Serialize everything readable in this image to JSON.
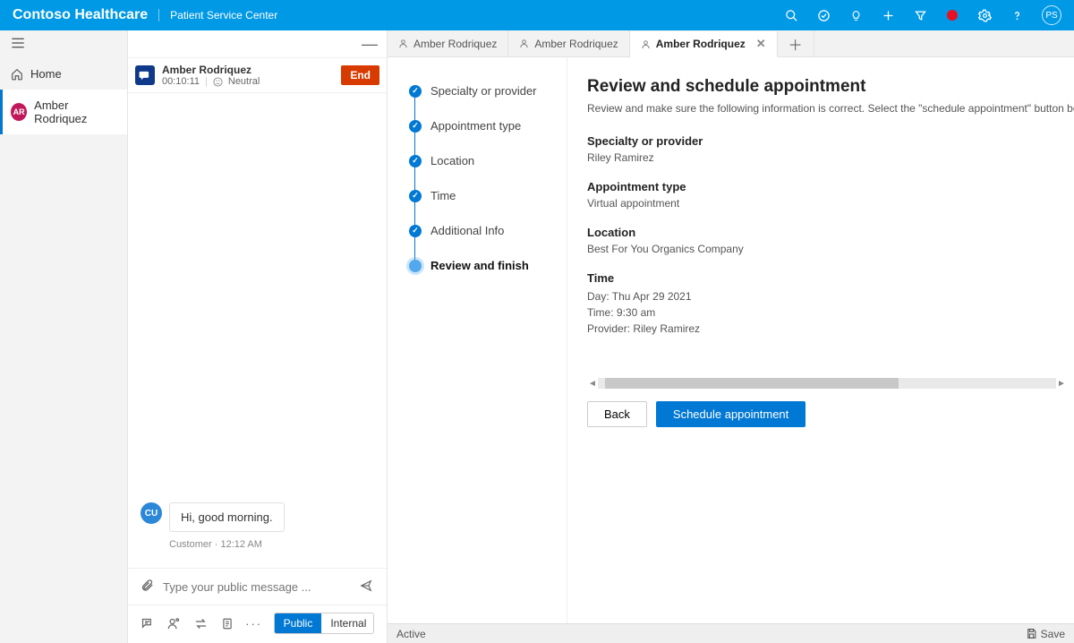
{
  "header": {
    "brand": "Contoso Healthcare",
    "subtitle": "Patient Service Center",
    "avatar_initials": "PS"
  },
  "nav": {
    "home": "Home",
    "patient": "Amber Rodriquez",
    "patient_initials": "AR"
  },
  "chat": {
    "session_name": "Amber Rodriquez",
    "session_timer": "00:10:11",
    "sentiment_label": "Neutral",
    "end_label": "End",
    "messages": [
      {
        "sender_initials": "CU",
        "text": "Hi, good morning.",
        "meta": "Customer · 12:12 AM"
      }
    ],
    "compose_placeholder": "Type your public message ...",
    "segment_public": "Public",
    "segment_internal": "Internal"
  },
  "tabs": [
    {
      "label": "Amber Rodriquez",
      "active": false
    },
    {
      "label": "Amber Rodriquez",
      "active": false
    },
    {
      "label": "Amber Rodriquez",
      "active": true
    }
  ],
  "stepper": [
    {
      "label": "Specialty or provider",
      "state": "done"
    },
    {
      "label": "Appointment type",
      "state": "done"
    },
    {
      "label": "Location",
      "state": "done"
    },
    {
      "label": "Time",
      "state": "done"
    },
    {
      "label": "Additional Info",
      "state": "done"
    },
    {
      "label": "Review and finish",
      "state": "current"
    }
  ],
  "review": {
    "title": "Review and schedule appointment",
    "subtitle": "Review and make sure the following information is correct. Select the \"schedule appointment\" button below to book the ap",
    "specialty_k": "Specialty or provider",
    "specialty_v": "Riley Ramirez",
    "appt_type_k": "Appointment type",
    "appt_type_v": "Virtual appointment",
    "location_k": "Location",
    "location_v": "Best For You Organics Company",
    "time_k": "Time",
    "time_day": "Day: Thu Apr 29 2021",
    "time_time": "Time: 9:30 am",
    "time_provider": "Provider: Riley Ramirez",
    "back_btn": "Back",
    "schedule_btn": "Schedule appointment"
  },
  "statusbar": {
    "state": "Active",
    "save": "Save"
  }
}
